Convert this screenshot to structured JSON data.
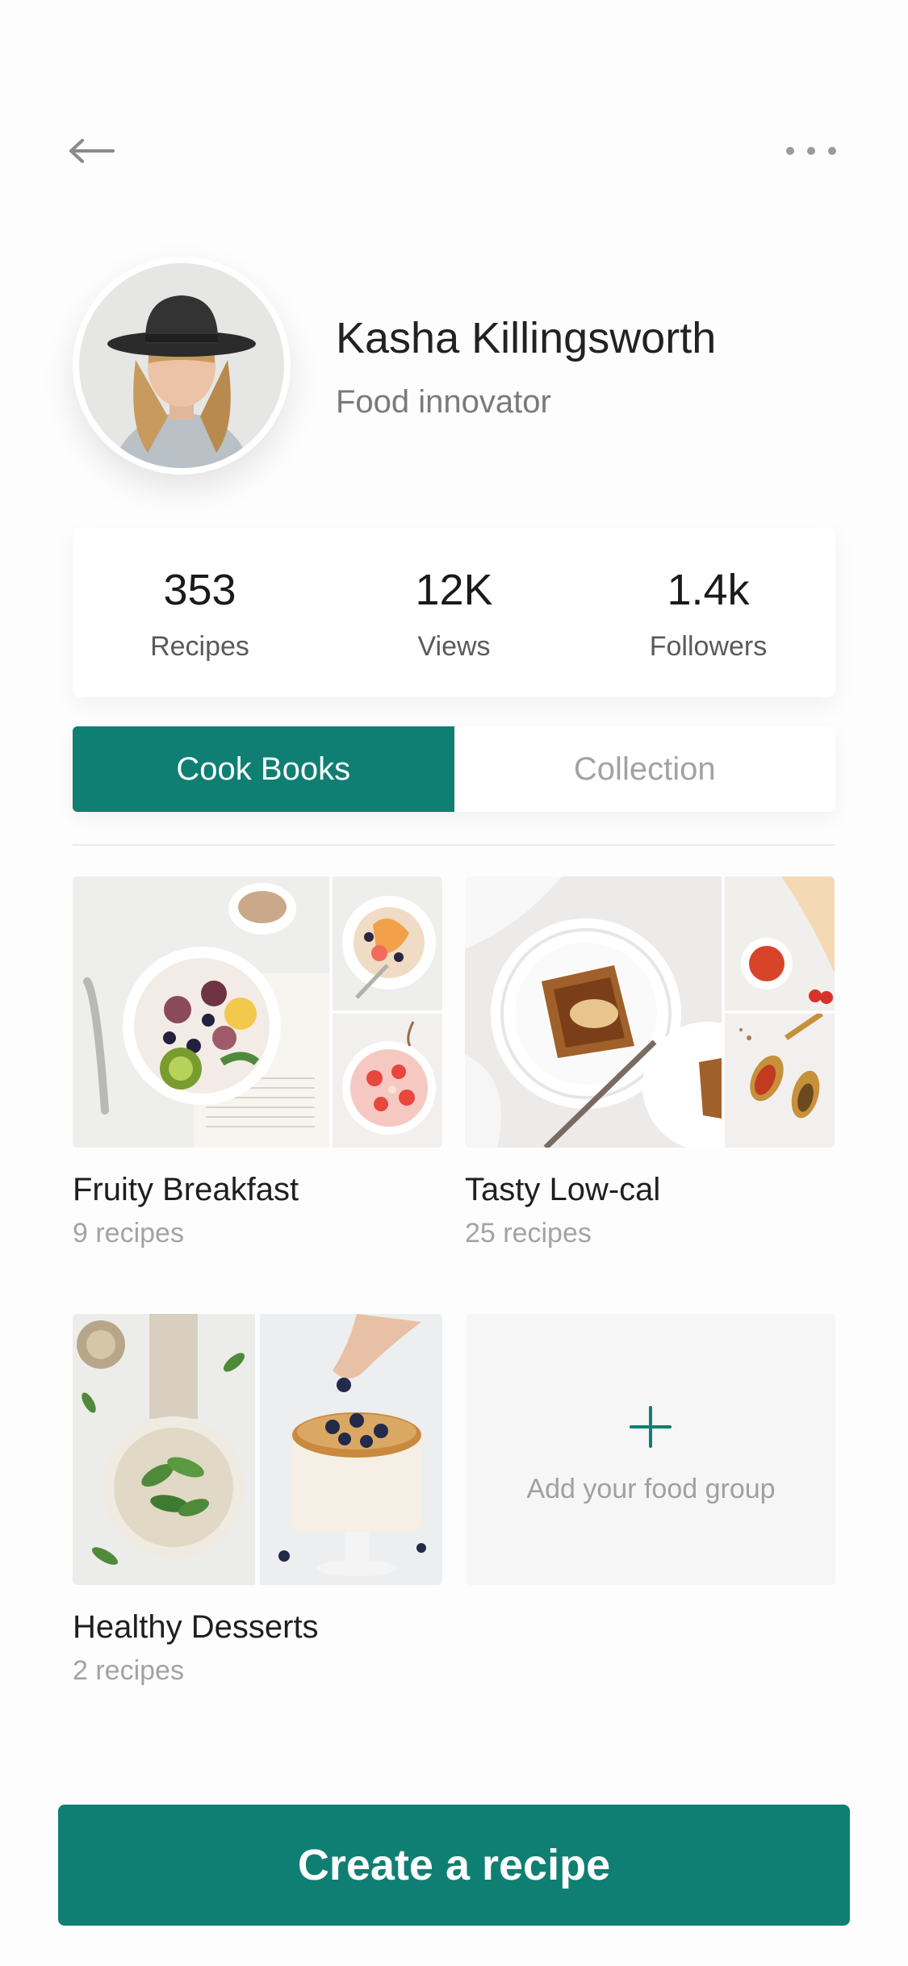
{
  "colors": {
    "accent": "#0f7f73",
    "background": "#fdfdfd",
    "muted_text": "#a3a3a3"
  },
  "header": {
    "back_icon": "arrow-left-icon",
    "more_icon": "more-horizontal-icon"
  },
  "profile": {
    "name": "Kasha Killingsworth",
    "role": "Food innovator",
    "avatar": "profile-photo"
  },
  "stats": [
    {
      "value": "353",
      "label": "Recipes"
    },
    {
      "value": "12K",
      "label": "Views"
    },
    {
      "value": "1.4k",
      "label": "Followers"
    }
  ],
  "tabs": [
    {
      "label": "Cook Books",
      "active": true
    },
    {
      "label": "Collection",
      "active": false
    }
  ],
  "cookbooks": [
    {
      "title": "Fruity Breakfast",
      "count": "9 recipes"
    },
    {
      "title": "Tasty Low-cal",
      "count": "25 recipes"
    },
    {
      "title": "Healthy Desserts",
      "count": "2 recipes"
    }
  ],
  "add_group": {
    "icon": "plus-icon",
    "label": "Add your food group"
  },
  "cta": {
    "label": "Create a recipe"
  }
}
